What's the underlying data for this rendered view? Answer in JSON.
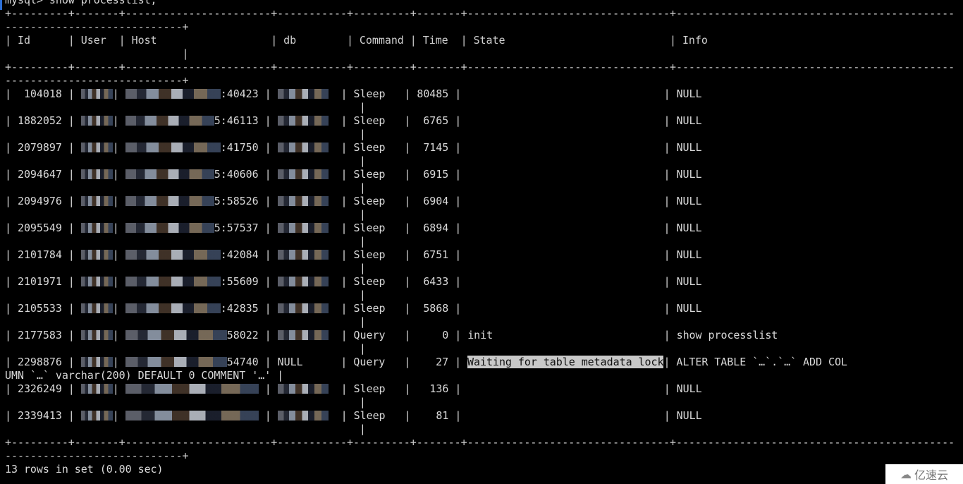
{
  "prompt": "mysql> show processlist;",
  "columns": [
    "Id",
    "User",
    "Host",
    "db",
    "Command",
    "Time",
    "State",
    "Info"
  ],
  "rows": [
    {
      "id": "104018",
      "host_suffix": ":40423",
      "command": "Sleep",
      "time": "80485",
      "state": "",
      "info": "NULL"
    },
    {
      "id": "1882052",
      "host_suffix": "5:46113",
      "command": "Sleep",
      "time": "6765",
      "state": "",
      "info": "NULL"
    },
    {
      "id": "2079897",
      "host_suffix": ":41750",
      "command": "Sleep",
      "time": "7145",
      "state": "",
      "info": "NULL"
    },
    {
      "id": "2094647",
      "host_suffix": "5:40606",
      "command": "Sleep",
      "time": "6915",
      "state": "",
      "info": "NULL"
    },
    {
      "id": "2094976",
      "host_suffix": "5:58526",
      "command": "Sleep",
      "time": "6904",
      "state": "",
      "info": "NULL"
    },
    {
      "id": "2095549",
      "host_suffix": "5:57537",
      "command": "Sleep",
      "time": "6894",
      "state": "",
      "info": "NULL"
    },
    {
      "id": "2101784",
      "host_suffix": ":42084",
      "command": "Sleep",
      "time": "6751",
      "state": "",
      "info": "NULL"
    },
    {
      "id": "2101971",
      "host_suffix": ":55609",
      "command": "Sleep",
      "time": "6433",
      "state": "",
      "info": "NULL"
    },
    {
      "id": "2105533",
      "host_suffix": ":42835",
      "command": "Sleep",
      "time": "5868",
      "state": "",
      "info": "NULL"
    },
    {
      "id": "2177583",
      "host_suffix": "58022",
      "command": "Query",
      "time": "0",
      "state": "init",
      "info": "show processlist"
    },
    {
      "id": "2298876",
      "host_suffix": "54740",
      "db": "NULL",
      "command": "Query",
      "time": "27",
      "state": "Waiting for table metadata lock",
      "info": "ALTER TABLE `…`.`…` ADD COL",
      "info_wrap": "UMN `…` varchar(200) DEFAULT 0 COMMENT '…' |"
    },
    {
      "id": "2326249",
      "host_suffix": "",
      "command": "Sleep",
      "time": "136",
      "state": "",
      "info": "NULL"
    },
    {
      "id": "2339413",
      "host_suffix": "",
      "command": "Sleep",
      "time": "81",
      "state": "",
      "info": "NULL"
    }
  ],
  "footer": "13 rows in set (0.00 sec)",
  "watermark": {
    "icon": "cloud-logo-icon",
    "text": "亿速云"
  }
}
